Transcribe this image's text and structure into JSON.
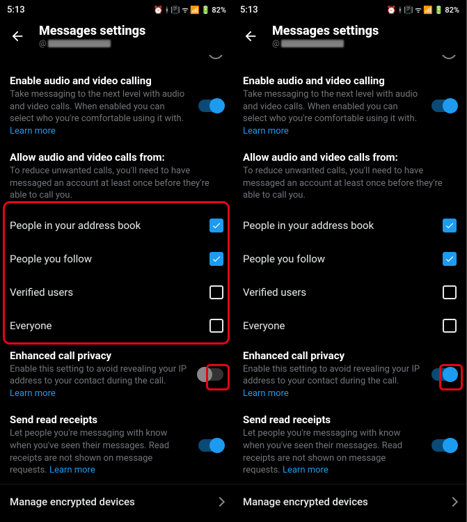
{
  "status": {
    "time": "5:13",
    "battery": "82%"
  },
  "header": {
    "title": "Messages settings",
    "handle_prefix": "@"
  },
  "peek": {
    "label": ""
  },
  "enable_calling": {
    "title": "Enable audio and video calling",
    "desc": "Take messaging to the next level with audio and video calls. When enabled you can select who you're comfortable using it with. ",
    "learn": "Learn more"
  },
  "allow_from": {
    "title": "Allow audio and video calls from:",
    "desc": "To reduce unwanted calls, you'll need to have messaged an account at least once before they're able to call you."
  },
  "options": {
    "address_book": "People in your address book",
    "follow": "People you follow",
    "verified": "Verified users",
    "everyone": "Everyone"
  },
  "enhanced": {
    "title": "Enhanced call privacy",
    "desc": "Enable this setting to avoid revealing your IP address to your contact during the call. ",
    "learn": "Learn more"
  },
  "receipts": {
    "title": "Send read receipts",
    "desc": "Let people you're messaging with know when you've seen their messages. Read receipts are not shown on message requests. ",
    "learn": "Learn more"
  },
  "manage": {
    "label": "Manage encrypted devices"
  },
  "state": {
    "left": {
      "calling": true,
      "addr": true,
      "follow": true,
      "verified": false,
      "everyone": false,
      "enhanced": false,
      "receipts": true
    },
    "right": {
      "calling": true,
      "addr": true,
      "follow": true,
      "verified": false,
      "everyone": false,
      "enhanced": true,
      "receipts": true
    }
  }
}
